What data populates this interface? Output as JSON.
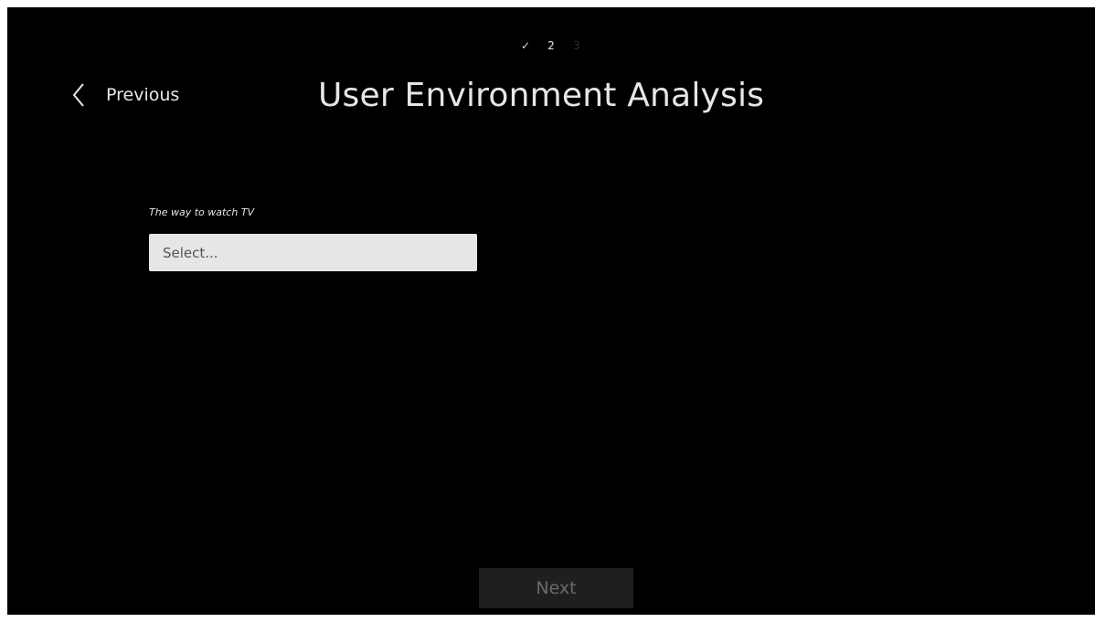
{
  "stepper": {
    "steps": [
      "✓",
      "2",
      "3"
    ]
  },
  "nav": {
    "back_label": "Previous",
    "back_icon": "chevron-left-icon"
  },
  "page": {
    "title": "User Environment Analysis"
  },
  "form": {
    "field_label": "The way to watch TV",
    "select_value": "Select..."
  },
  "footer": {
    "next_label": "Next"
  },
  "colors": {
    "background": "#000000",
    "text": "#e6e6e6",
    "select_bg": "#e6e6e6",
    "button_bg": "#1f1f1f",
    "button_text_disabled": "#6a6a6a"
  }
}
